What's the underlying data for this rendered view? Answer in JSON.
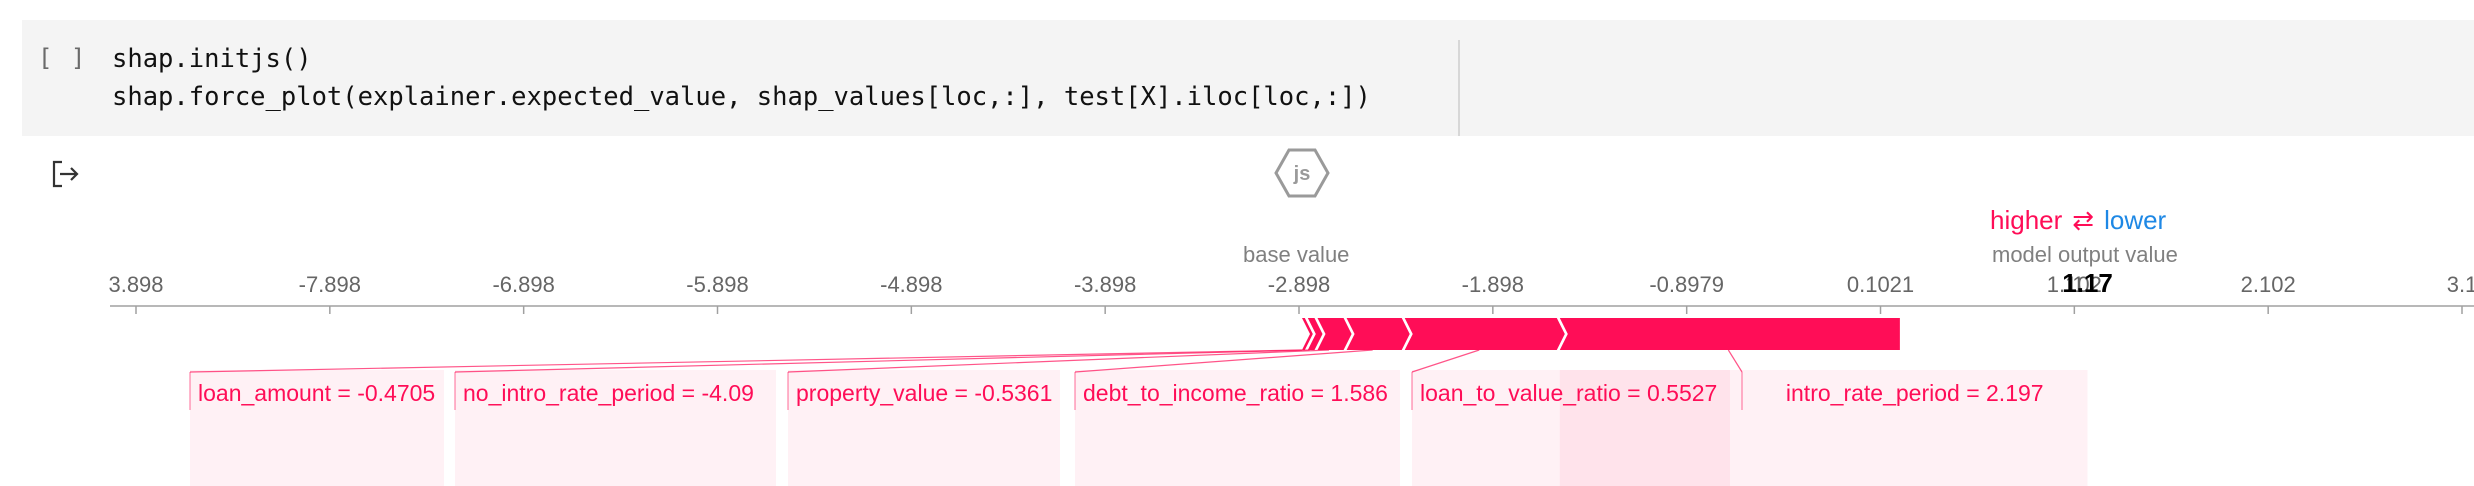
{
  "cell": {
    "run_indicator": "[ ]",
    "code_lines": [
      "shap.initjs()",
      "shap.force_plot(explainer.expected_value, shap_values[loc,:], test[X].iloc[loc,:])"
    ]
  },
  "output": {
    "js_logo_text": "js"
  },
  "chart_data": {
    "type": "force_plot",
    "legend": {
      "higher": "higher",
      "arrow": "⇄",
      "lower": "lower"
    },
    "base_value_label": "base value",
    "output_value_label": "model output value",
    "output_value": "1.17",
    "output_value_numeric": 1.17,
    "output_value_prefix": "1",
    "base_value": -2.898,
    "xlim": [
      -8.898,
      3.102
    ],
    "ticks": [
      "3.898",
      "-7.898",
      "-6.898",
      "-5.898",
      "-4.898",
      "-3.898",
      "-2.898",
      "-1.898",
      "-0.8979",
      "0.1021",
      "1.102",
      "2.102",
      "3.1"
    ],
    "tick_values": [
      -8.898,
      -7.898,
      -6.898,
      -5.898,
      -4.898,
      -3.898,
      -2.898,
      -1.898,
      -0.8979,
      0.1021,
      1.102,
      2.102,
      3.102
    ],
    "features": [
      {
        "label": "loan_amount = -0.4705",
        "shap": 0.03
      },
      {
        "label": "no_intro_rate_period = -4.09",
        "shap": 0.05
      },
      {
        "label": "property_value = -0.5361",
        "shap": 0.15
      },
      {
        "label": "debt_to_income_ratio = 1.586",
        "shap": 0.3
      },
      {
        "label": "loan_to_value_ratio = 0.5527",
        "shap": 0.8
      },
      {
        "label": "intro_rate_period = 2.197",
        "shap": 1.77
      }
    ],
    "colors": {
      "positive": "#ff0d57",
      "negative": "#1e88e5",
      "axis": "#a0a0a0",
      "tick_text": "#666666"
    }
  }
}
